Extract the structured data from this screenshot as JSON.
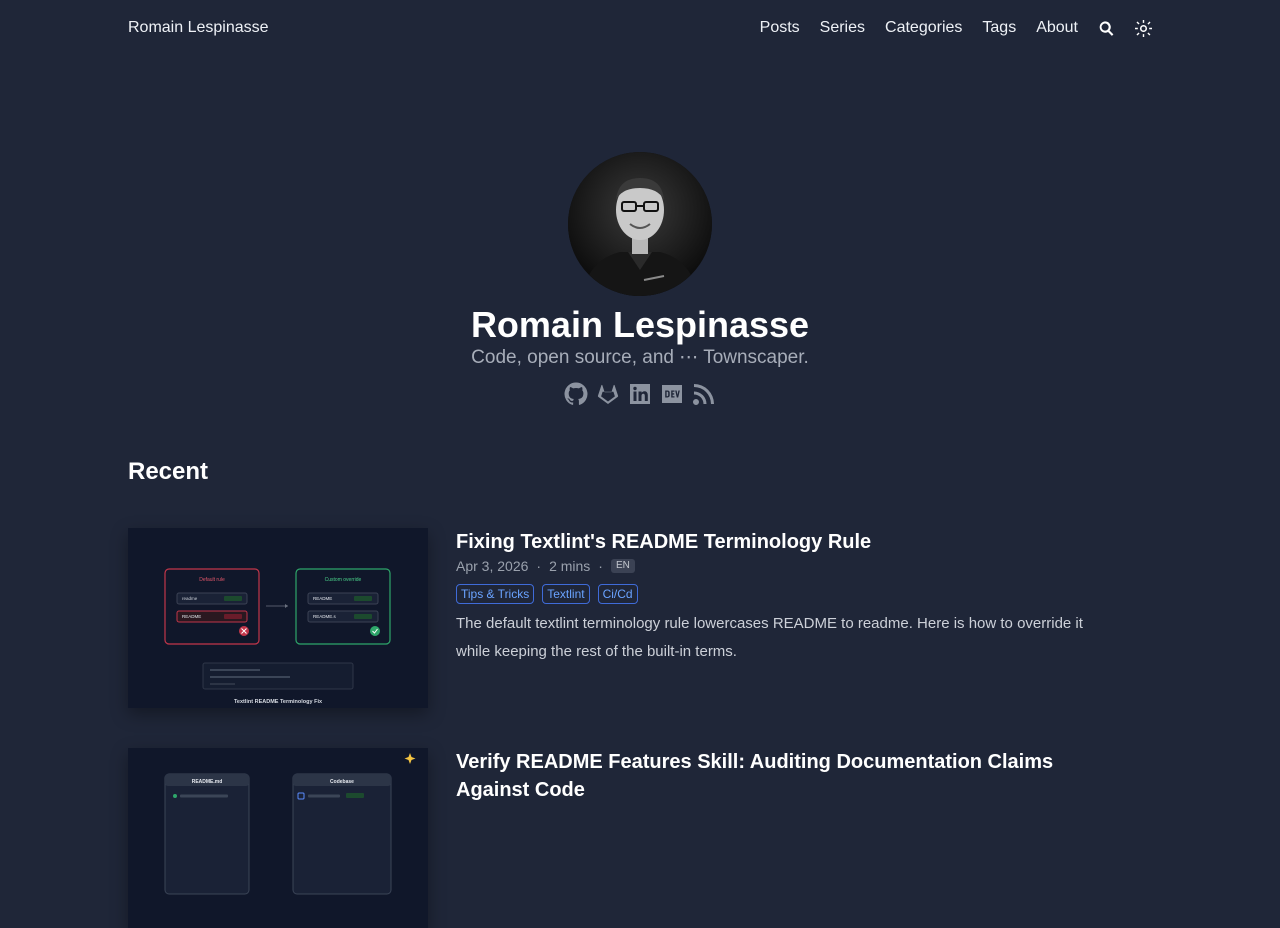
{
  "nav": {
    "brand": "Romain Lespinasse",
    "items": [
      "Posts",
      "Series",
      "Categories",
      "Tags",
      "About"
    ],
    "search_icon": "search-icon",
    "theme_icon": "sun-icon"
  },
  "profile": {
    "name": "Romain Lespinasse",
    "tagline": "Code, open source, and ⋯ Townscaper.",
    "social_icons": [
      "github-icon",
      "gitlab-icon",
      "linkedin-icon",
      "dev-icon",
      "rss-icon"
    ]
  },
  "recent": {
    "heading": "Recent"
  },
  "posts": [
    {
      "title": "Fixing Textlint's README Terminology Rule",
      "date": "Apr 3, 2026",
      "reading_time": "2 mins",
      "lang": "EN",
      "tags": [
        "Tips & Tricks",
        "Textlint",
        "Ci/Cd"
      ],
      "summary": "The default textlint terminology rule lowercases README to readme. Here is how to override it while keeping the rest of the built-in terms.",
      "thumb": {
        "left_box": "Default rule",
        "right_box": "Custom override",
        "left_row1": "readme",
        "left_row2": "README",
        "right_row1": "README",
        "right_row2": "README.s",
        "caption": "Textlint README Terminology Fix"
      }
    },
    {
      "title": "Verify README Features Skill: Auditing Documentation Claims Against Code",
      "thumb": {
        "left_box": "README.md",
        "right_box": "Codebase"
      }
    }
  ],
  "colors": {
    "background": "#1f2638",
    "tag_accent": "#6aa3ff",
    "text": "#ffffff",
    "muted": "#9aa1ad"
  },
  "separator": "·"
}
